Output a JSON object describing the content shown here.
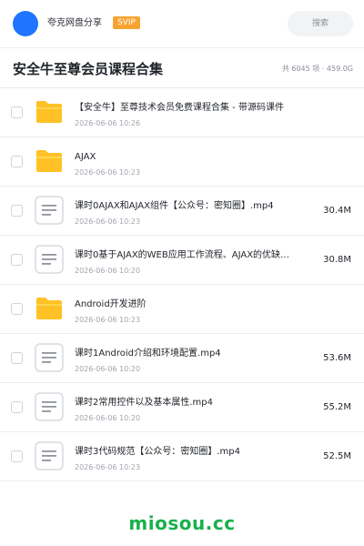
{
  "header": {
    "user_name": "夸克网盘分享",
    "badge": "SVIP",
    "search_label": "搜索"
  },
  "folder": {
    "title": "安全牛至尊会员课程合集",
    "summary": "共 6045 项 · 459.0G"
  },
  "files": [
    {
      "name": "【安全牛】至尊技术会员免费课程合集 - 带源码课件",
      "date": "2026-06-06 10:26",
      "size": "",
      "type": "folder"
    },
    {
      "name": "AJAX",
      "date": "2026-06-06 10:23",
      "size": "",
      "type": "folder"
    },
    {
      "name": "课时0AJAX和AJAX组件【公众号：密知圈】.mp4",
      "date": "2026-06-06 10:23",
      "size": "30.4M",
      "type": "video"
    },
    {
      "name": "课时0基于AJAX的WEB应用工作流程、AJAX的优缺点.mp4",
      "date": "2026-06-06 10:20",
      "size": "30.8M",
      "type": "video"
    },
    {
      "name": "Android开发进阶",
      "date": "2026-06-06 10:23",
      "size": "",
      "type": "folder"
    },
    {
      "name": "课时1Android介绍和环境配置.mp4",
      "date": "2026-06-06 10:20",
      "size": "53.6M",
      "type": "video"
    },
    {
      "name": "课时2常用控件以及基本属性.mp4",
      "date": "2026-06-06 10:20",
      "size": "55.2M",
      "type": "video"
    },
    {
      "name": "课时3代码规范【公众号：密知圈】.mp4",
      "date": "2026-06-06 10:23",
      "size": "52.5M",
      "type": "video"
    }
  ],
  "watermark": "miosou.cc",
  "colors": {
    "avatar": "#1f75ff",
    "svip_badge": "#f7a332",
    "folder_icon": "#ffc125",
    "watermark": "#18b04c"
  },
  "icons": {
    "folder": "folder-icon",
    "video": "document-lines-icon"
  }
}
